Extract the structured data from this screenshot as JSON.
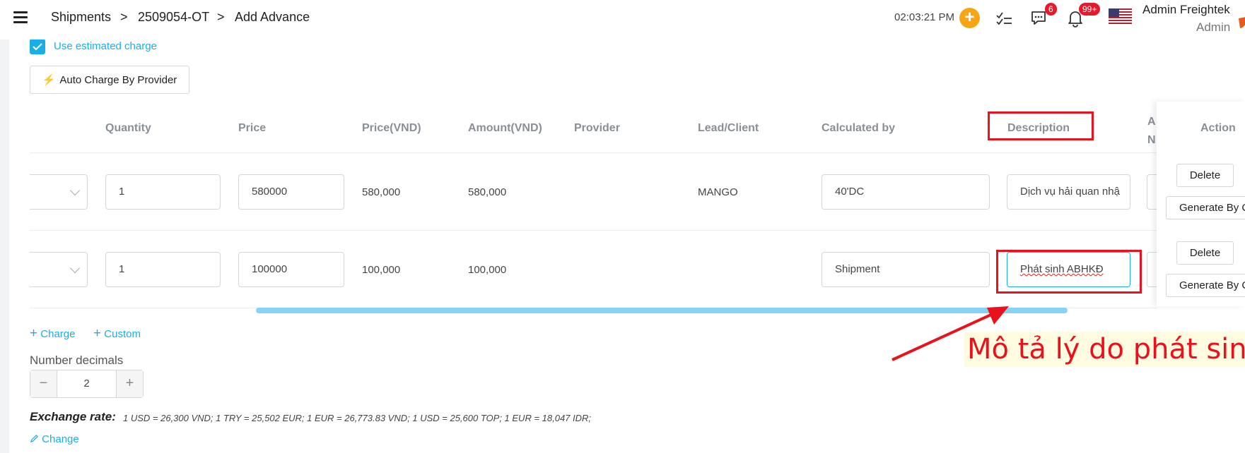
{
  "header": {
    "breadcrumb": [
      "Shipments",
      "2509054-OT",
      "Add Advance"
    ],
    "separator": ">",
    "clock": "02:03:21 PM",
    "chat_badge": "6",
    "notif_badge": "99+",
    "user_name": "Admin Freightek",
    "user_role": "Admin"
  },
  "options": {
    "use_estimated_label": "Use estimated charge",
    "auto_charge_label": "Auto Charge By Provider"
  },
  "table": {
    "headers": {
      "quantity": "Quantity",
      "price": "Price",
      "price_vnd": "Price(VND)",
      "amount_vnd": "Amount(VND)",
      "provider": "Provider",
      "lead_client": "Lead/Client",
      "calculated_by": "Calculated by",
      "description": "Description",
      "peek": "A\nN",
      "action": "Action"
    },
    "rows": [
      {
        "quantity": "1",
        "price": "580000",
        "price_vnd": "580,000",
        "amount_vnd": "580,000",
        "provider": "",
        "lead_client": "MANGO",
        "calculated_by": "40'DC",
        "description": "Dịch vụ hải quan nhậ",
        "delete_label": "Delete",
        "generate_label": "Generate By C"
      },
      {
        "quantity": "1",
        "price": "100000",
        "price_vnd": "100,000",
        "amount_vnd": "100,000",
        "provider": "",
        "lead_client": "",
        "calculated_by": "Shipment",
        "description": "Phát sinh ABHKĐ",
        "delete_label": "Delete",
        "generate_label": "Generate By C"
      }
    ]
  },
  "add_links": {
    "charge": "Charge",
    "custom": "Custom"
  },
  "decimals": {
    "label": "Number decimals",
    "value": "2"
  },
  "exchange": {
    "label": "Exchange rate:",
    "value": "1 USD = 26,300 VND; 1 TRY = 25,502 EUR; 1 EUR = 26,773.83 VND; 1 USD = 25,600 TOP; 1 EUR = 18,047 IDR;",
    "change_label": "Change"
  },
  "annotation": {
    "text": "Mô tả lý do phát sinh",
    "color": "#e8111c"
  },
  "colors": {
    "accent": "#1aaee8",
    "orange": "#f7a515",
    "badge": "#e8192c"
  }
}
